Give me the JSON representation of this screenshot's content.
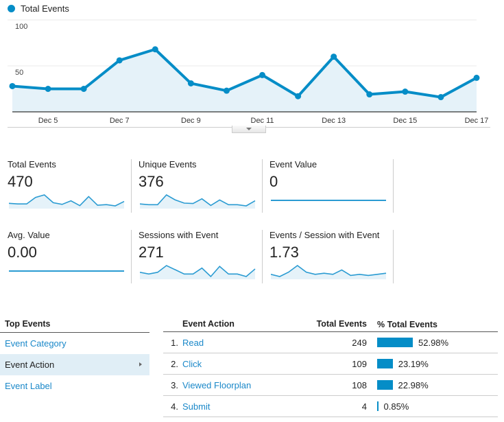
{
  "chart_data": {
    "type": "line",
    "title": "",
    "legend": [
      "Total Events"
    ],
    "legend_position": "top-left",
    "x": [
      "Dec 4",
      "Dec 5",
      "Dec 6",
      "Dec 7",
      "Dec 8",
      "Dec 9",
      "Dec 10",
      "Dec 11",
      "Dec 12",
      "Dec 13",
      "Dec 14",
      "Dec 15",
      "Dec 16",
      "Dec 17"
    ],
    "x_tick_labels": [
      "Dec 5",
      "Dec 7",
      "Dec 9",
      "Dec 11",
      "Dec 13",
      "Dec 15",
      "Dec 17"
    ],
    "series": [
      {
        "name": "Total Events",
        "values": [
          28,
          25,
          25,
          56,
          68,
          31,
          23,
          40,
          17,
          60,
          19,
          22,
          16,
          37
        ]
      }
    ],
    "y_tick_labels": [
      "100",
      "50"
    ],
    "ylim": [
      0,
      100
    ],
    "grid": true,
    "color": "#058dc7",
    "fill": "#e5f2f9"
  },
  "metrics": [
    {
      "label": "Total Events",
      "value": "470",
      "spark": [
        28,
        25,
        25,
        56,
        68,
        31,
        23,
        40,
        17,
        60,
        19,
        22,
        16,
        37
      ]
    },
    {
      "label": "Unique Events",
      "value": "376",
      "spark": [
        22,
        20,
        20,
        45,
        32,
        24,
        23,
        35,
        18,
        32,
        20,
        20,
        17,
        30
      ]
    },
    {
      "label": "Event Value",
      "value": "0",
      "spark": [
        0,
        0,
        0,
        0,
        0,
        0,
        0,
        0,
        0,
        0,
        0,
        0,
        0,
        0
      ]
    },
    {
      "label": "Avg. Value",
      "value": "0.00",
      "spark": [
        0,
        0,
        0,
        0,
        0,
        0,
        0,
        0,
        0,
        0,
        0,
        0,
        0,
        0
      ]
    },
    {
      "label": "Sessions with Event",
      "value": "271",
      "spark": [
        18,
        16,
        18,
        26,
        21,
        16,
        16,
        23,
        13,
        25,
        16,
        16,
        13,
        22
      ]
    },
    {
      "label": "Events / Session with Event",
      "value": "1.73",
      "spark": [
        1.5,
        1.4,
        1.6,
        1.9,
        1.6,
        1.5,
        1.55,
        1.5,
        1.7,
        1.45,
        1.5,
        1.45,
        1.5,
        1.55
      ]
    }
  ],
  "top_events": {
    "header": "Top Events",
    "items": [
      {
        "label": "Event Category",
        "active": false
      },
      {
        "label": "Event Action",
        "active": true
      },
      {
        "label": "Event Label",
        "active": false
      }
    ]
  },
  "table": {
    "headers": {
      "name": "Event Action",
      "total": "Total Events",
      "pct": "% Total Events"
    },
    "rows": [
      {
        "num": "1.",
        "name": "Read",
        "total": "249",
        "pct": "52.98%",
        "pct_value": 52.98
      },
      {
        "num": "2.",
        "name": "Click",
        "total": "109",
        "pct": "23.19%",
        "pct_value": 23.19
      },
      {
        "num": "3.",
        "name": "Viewed Floorplan",
        "total": "108",
        "pct": "22.98%",
        "pct_value": 22.98
      },
      {
        "num": "4.",
        "name": "Submit",
        "total": "4",
        "pct": "0.85%",
        "pct_value": 0.85
      }
    ]
  }
}
